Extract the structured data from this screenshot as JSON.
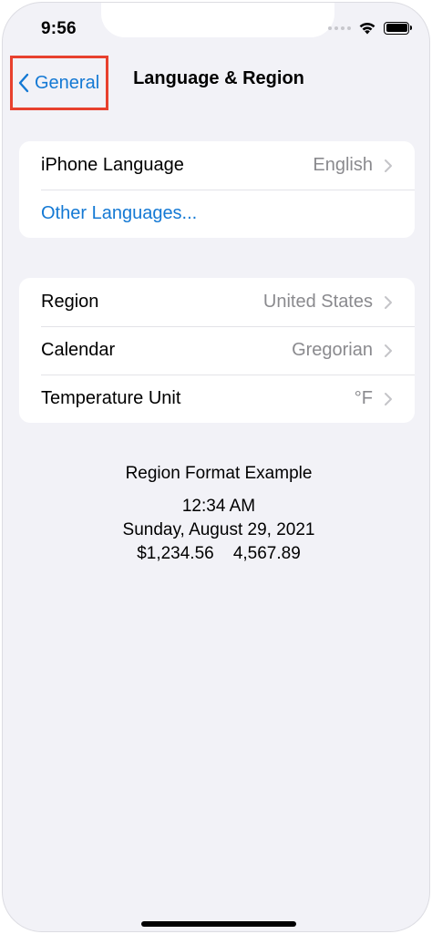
{
  "status_bar": {
    "time": "9:56"
  },
  "nav": {
    "back_label": "General",
    "title": "Language & Region"
  },
  "language_group": {
    "rows": [
      {
        "label": "iPhone Language",
        "value": "English"
      },
      {
        "label": "Other Languages..."
      }
    ]
  },
  "region_group": {
    "rows": [
      {
        "label": "Region",
        "value": "United States"
      },
      {
        "label": "Calendar",
        "value": "Gregorian"
      },
      {
        "label": "Temperature Unit",
        "value": "°F"
      }
    ]
  },
  "region_format": {
    "heading": "Region Format Example",
    "time": "12:34 AM",
    "date": "Sunday, August 29, 2021",
    "numbers": "$1,234.56    4,567.89"
  },
  "colors": {
    "accent": "#1479d4",
    "highlight_box": "#e8412e",
    "background": "#f2f2f7",
    "secondary_text": "#8a8a8e"
  },
  "icons": {
    "back": "chevron-left-icon",
    "disclosure": "chevron-right-icon",
    "wifi": "wifi-icon",
    "battery": "battery-icon",
    "signal": "cellular-signal-icon"
  }
}
